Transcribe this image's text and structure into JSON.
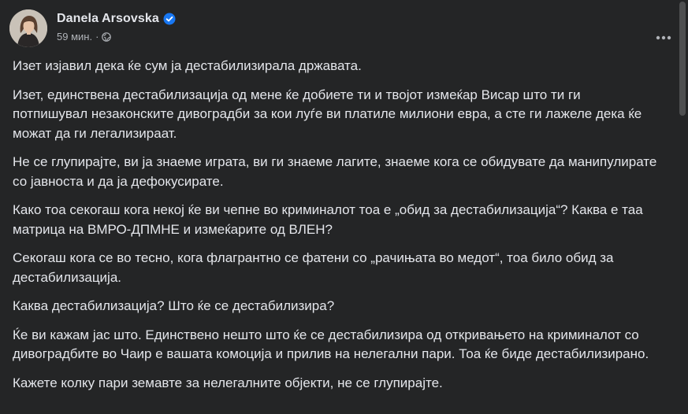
{
  "post": {
    "author": "Danela Arsovska",
    "verified": true,
    "timestamp": "59 мин.",
    "separator": "·",
    "audience_icon": "globe-icon",
    "more_icon": "more-options-icon",
    "paragraphs": [
      "Изет изјавил дека ќе сум ја дестабилизирала државата.",
      "Изет, единствена дестабилизација од мене ќе добиете ти и твојот измеќар Висар што ти ги потпишувал незаконските дивоградби за кои луѓе ви платиле милиони евра, а сте ги лажеле дека ќе можат да ги легализираат.",
      "Не се глупирајте, ви ја знаеме играта, ви ги знаеме лагите, знаеме кога се обидувате да манипулирате со јавноста и да ја дефокусирате.",
      "Како тоа секогаш кога некој ќе ви чепне во криминалот тоа е „обид за дестабилизација“? Каква е таа матрица на ВМРО-ДПМНЕ и измеќарите од ВЛЕН?",
      "Секогаш кога се во тесно, кога флагрантно се фатени со „рачињата во медот“, тоа било обид за дестабилизација.",
      "Каква дестабилизација? Што ќе се дестабилизира?",
      "Ќе ви кажам јас што. Единствено нешто што ќе се дестабилизира од откривањето на криминалот со дивоградбите во Чаир е вашата комоција и прилив на нелегални пари. Тоа ќе биде дестабилизирано.",
      "Кажете колку пари земавте за нелегалните објекти, не се глупирајте."
    ]
  },
  "colors": {
    "background": "#242526",
    "primary_text": "#e4e6eb",
    "secondary_text": "#b0b3b8",
    "verified_badge": "#1877f2",
    "scrollbar_thumb": "#4e4f50"
  }
}
